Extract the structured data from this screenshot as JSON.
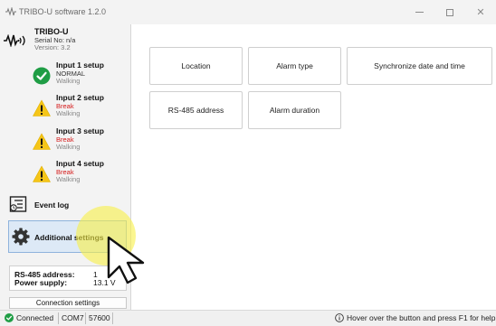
{
  "window": {
    "title": "TRIBO-U software 1.2.0",
    "icon": "tribo-wave-icon",
    "controls": [
      "minimize",
      "maximize",
      "close"
    ]
  },
  "device": {
    "name": "TRIBO-U",
    "serial": "Serial No: n/a",
    "version": "Version: 3.2"
  },
  "inputs": [
    {
      "label": "Input  1 setup",
      "state": "NORMAL",
      "mode": "Walking",
      "status_icon": "check-circle-icon",
      "state_color": "#333333"
    },
    {
      "label": "Input  2 setup",
      "state": "Break",
      "mode": "Walking",
      "status_icon": "warning-icon",
      "state_color": "#d41a1a"
    },
    {
      "label": "Input  3 setup",
      "state": "Break",
      "mode": "Walking",
      "status_icon": "warning-icon",
      "state_color": "#d41a1a"
    },
    {
      "label": "Input  4 setup",
      "state": "Break",
      "mode": "Walking",
      "status_icon": "warning-icon",
      "state_color": "#d41a1a"
    }
  ],
  "nav": {
    "event_log": "Event log",
    "additional_settings": "Additional settings"
  },
  "status_box": {
    "rs485_label": "RS-485 address:",
    "rs485_value": "1",
    "power_label": "Power supply:",
    "power_value": "13.1 V"
  },
  "connection_button": "Connection settings",
  "actions": [
    "Location",
    "Alarm type",
    "Synchronize date and time",
    "RS-485 address",
    "Alarm duration"
  ],
  "statusbar": {
    "connection": "Connected",
    "port": "COM7",
    "baud": "57600",
    "help": "Hover over the button and press F1 for help"
  },
  "colors": {
    "ok_green": "#1f9d45",
    "warning_yellow": "#f5c518",
    "break_red": "#d41a1a",
    "selected_bg": "#dde9f6",
    "selected_border": "#8eb3dc",
    "cursor_highlight": "#f8f046"
  }
}
